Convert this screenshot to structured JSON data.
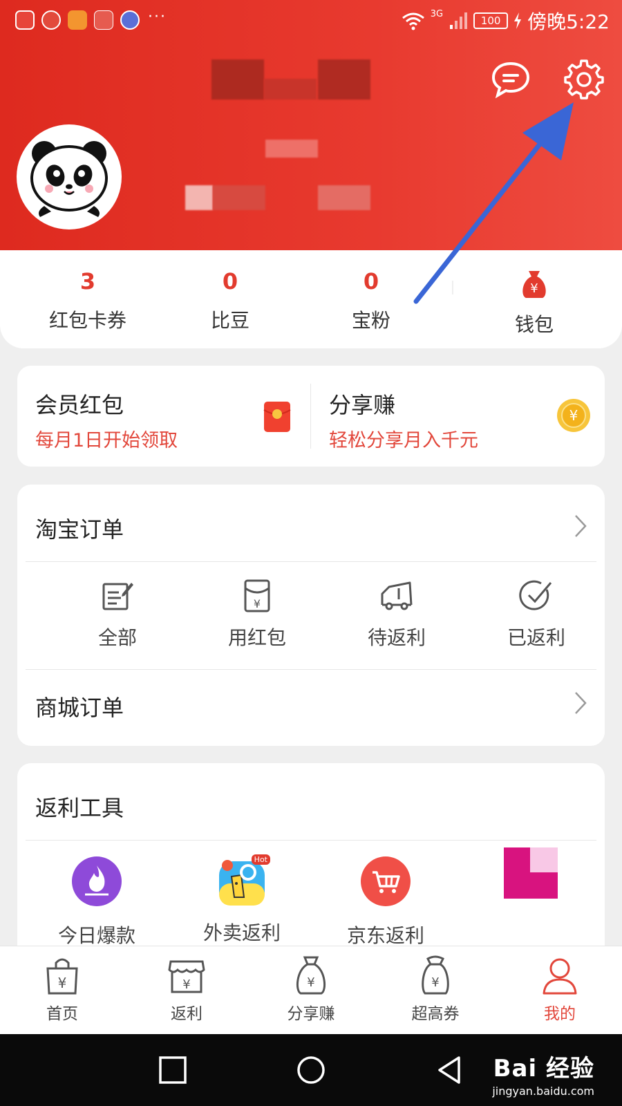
{
  "status_bar": {
    "network": "3G",
    "battery": "100",
    "time": "傍晚5:22",
    "more": "···",
    "notification_icons": [
      "toutiao-icon",
      "hand-icon",
      "app-icon",
      "huawei-icon",
      "browser-icon"
    ]
  },
  "header": {
    "message_icon": "chat-bubble-icon",
    "settings_icon": "gear-icon"
  },
  "stats": [
    {
      "value": "3",
      "label": "红包卡券"
    },
    {
      "value": "0",
      "label": "比豆"
    },
    {
      "value": "0",
      "label": "宝粉"
    },
    {
      "label": "钱包",
      "icon": "money-bag-icon"
    }
  ],
  "promo": [
    {
      "title": "会员红包",
      "subtitle": "每月1日开始领取",
      "icon": "red-envelope-icon"
    },
    {
      "title": "分享赚",
      "subtitle": "轻松分享月入千元",
      "icon": "gold-coin-icon"
    }
  ],
  "orders": {
    "taobao_title": "淘宝订单",
    "items": [
      {
        "label": "全部",
        "icon": "edit-list-icon"
      },
      {
        "label": "用红包",
        "icon": "red-envelope-outline-icon"
      },
      {
        "label": "待返利",
        "icon": "truck-icon"
      },
      {
        "label": "已返利",
        "icon": "check-circle-icon"
      }
    ],
    "mall_title": "商城订单"
  },
  "tools": {
    "title": "返利工具",
    "hot_badge": "Hot",
    "items": [
      {
        "label": "今日爆款",
        "icon": "fire-icon"
      },
      {
        "label": "外卖返利",
        "icon": "takeout-icon"
      },
      {
        "label": "京东返利",
        "icon": "cart-icon"
      }
    ]
  },
  "tabs": [
    {
      "label": "首页",
      "icon": "shopping-bag-icon"
    },
    {
      "label": "返利",
      "icon": "store-icon"
    },
    {
      "label": "分享赚",
      "icon": "money-bag-icon"
    },
    {
      "label": "超高券",
      "icon": "coupon-bag-icon"
    },
    {
      "label": "我的",
      "icon": "person-icon",
      "active": true
    }
  ],
  "watermark": {
    "main": "Bai 经验",
    "sub": "jingyan.baidu.com"
  },
  "colors": {
    "brand_red": "#e23b2e",
    "header_gradient_start": "#de2a1f",
    "header_gradient_end": "#ee4c40",
    "annotation_arrow": "#3a66d6",
    "active_tab": "#e2473b"
  }
}
